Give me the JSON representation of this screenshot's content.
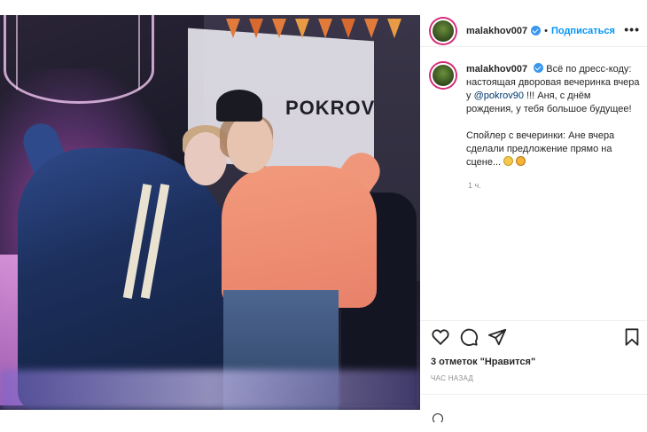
{
  "post": {
    "username": "malakhov007",
    "follow_label": "Подписаться",
    "separator": "•",
    "more_label": "•••",
    "caption": {
      "username": "malakhov007",
      "text_before_mention": "Всё по дресс-коду: настоящая дворовая вечеринка вчера у ",
      "mention": "@pokrov90",
      "text_after_mention": " !!! Аня, с днём рождения, у тебя большое будущее!",
      "paragraph2": "Спойлер с вечеринки: Ане вчера сделали предложение прямо на сцене..."
    },
    "time_ago": "1 ч.",
    "likes": "3 отметок \"Нравится\"",
    "posted_ago": "ЧАС НАЗАД",
    "photo_sign": "POKROV"
  },
  "colors": {
    "follow": "#0095f6",
    "verified": "#3897f0",
    "mention": "#00376b",
    "muted": "#8e8e8e"
  },
  "icons": [
    "verified-badge-icon",
    "more-options-icon",
    "heart-icon",
    "comment-icon",
    "share-icon",
    "save-icon",
    "emoji-ring-icon",
    "emoji-scream-icon"
  ]
}
